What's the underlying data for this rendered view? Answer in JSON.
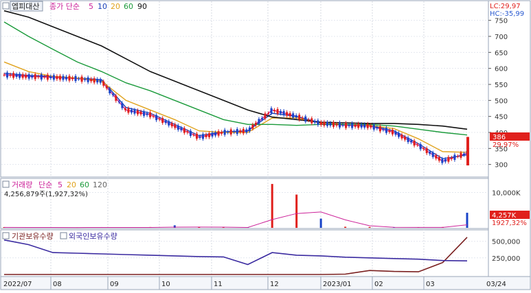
{
  "stock": {
    "name": "엡피대산",
    "lc_label": "LC:29,97",
    "hc_label": "HC:-35,99",
    "price_tag": "386",
    "change_tag": "29,97%"
  },
  "price_legend": {
    "prefix": "종가 단순",
    "periods": [
      "5",
      "10",
      "20",
      "60",
      "90"
    ]
  },
  "volume_legend": {
    "title": "거래량",
    "method": "단순",
    "periods": [
      "5",
      "20",
      "60",
      "120"
    ],
    "summary": "4,256,879주(1,927,32%)",
    "tag": "4,257K",
    "tag_pct": "1927,32%"
  },
  "flow_legend": {
    "series1": "기관보유수량",
    "series2": "외국인보유수량"
  },
  "colors": {
    "ma5": "#cc2299",
    "ma10": "#1a3fb8",
    "ma20": "#e0a21c",
    "ma60": "#1a9a3a",
    "ma90": "#111111",
    "up": "#e0201c",
    "down": "#1a44c8",
    "vol_ma5": "#cc2299",
    "vol_ma20": "#e0a21c",
    "vol_ma60": "#1a9a3a",
    "inst": "#7a1f1f",
    "foreign": "#3a2aa0",
    "tag_red": "#e0201c",
    "tag_blue": "#2a5ad0"
  },
  "chart_data": [
    {
      "type": "line",
      "title": "엡피대산 price",
      "x": [
        "2022/07",
        "08",
        "09",
        "10",
        "11",
        "12",
        "2023/01",
        "02",
        "03"
      ],
      "y_ticks": [
        750,
        700,
        650,
        600,
        550,
        500,
        450,
        400,
        350,
        300
      ],
      "ylim": [
        265,
        775
      ],
      "series": [
        {
          "name": "5",
          "values": [
            580,
            575,
            572,
            568,
            560,
            470,
            455,
            420,
            385,
            400,
            405,
            470,
            450,
            428,
            422,
            420,
            400,
            360,
            310,
            335
          ]
        },
        {
          "name": "10",
          "values": [
            585,
            578,
            575,
            570,
            565,
            478,
            460,
            425,
            390,
            402,
            405,
            460,
            450,
            430,
            425,
            422,
            405,
            365,
            318,
            330
          ]
        },
        {
          "name": "20",
          "values": [
            620,
            590,
            575,
            570,
            560,
            500,
            470,
            440,
            405,
            400,
            400,
            445,
            445,
            430,
            425,
            422,
            412,
            380,
            340,
            338
          ]
        },
        {
          "name": "60",
          "values": [
            745,
            700,
            660,
            620,
            590,
            555,
            530,
            500,
            470,
            440,
            425,
            425,
            422,
            425,
            425,
            425,
            420,
            410,
            400,
            392
          ]
        },
        {
          "name": "90",
          "values": [
            780,
            760,
            730,
            700,
            670,
            630,
            590,
            560,
            530,
            500,
            470,
            448,
            440,
            432,
            430,
            428,
            428,
            425,
            420,
            410
          ]
        }
      ]
    },
    {
      "type": "bar",
      "title": "거래량",
      "y_ticks": [
        "10,000K"
      ],
      "values_k": [
        200,
        150,
        180,
        120,
        200,
        160,
        220,
        700,
        250,
        140,
        180,
        12400,
        9400,
        2600,
        300,
        240,
        200,
        180,
        220,
        4257
      ]
    },
    {
      "type": "line",
      "title": "기관보유수량 / 외국인보유수량",
      "y_ticks": [
        "500,000",
        "250,000"
      ],
      "series": [
        {
          "name": "기관보유수량",
          "values": [
            0,
            0,
            0,
            0,
            0,
            0,
            0,
            0,
            0,
            0,
            0,
            0,
            0,
            0,
            5000,
            60000,
            45000,
            40000,
            180000,
            560000
          ]
        },
        {
          "name": "외국인보유수량",
          "values": [
            520000,
            450000,
            330000,
            320000,
            310000,
            300000,
            290000,
            280000,
            270000,
            265000,
            150000,
            330000,
            290000,
            280000,
            260000,
            250000,
            240000,
            230000,
            210000,
            205000
          ]
        }
      ]
    }
  ],
  "x_axis_labels": [
    "2022/07",
    "08",
    "09",
    "10",
    "11",
    "12",
    "2023/01",
    "02",
    "03",
    "03/24"
  ]
}
